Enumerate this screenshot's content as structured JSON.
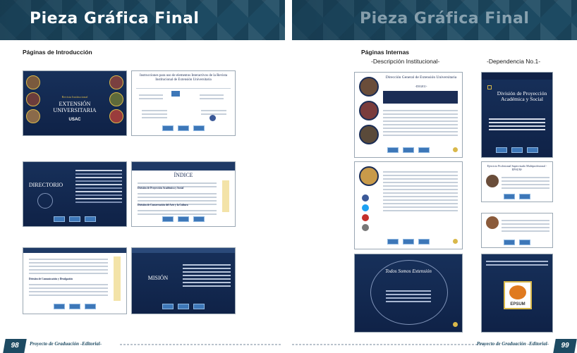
{
  "left_page": {
    "title": "Pieza Gráfica Final",
    "section": "Páginas de Introducción",
    "page_number": "98",
    "footer": "Proyecto de Graduación -Editorial-",
    "cover": {
      "line1": "Revista Institucional",
      "line2": "EXTENSIÓN",
      "line3": "UNIVERSITARIA",
      "logo": "USAC"
    },
    "instructions": {
      "title": "Instrucciones para uso de elementos Interactivos de la Revista Institucional de Extensión Universitaria"
    },
    "directorio": {
      "title": "DIRECTORIO"
    },
    "indice": {
      "title": "ÍNDICE",
      "heading1": "División de Proyección Académica y Social",
      "heading2": "División de Conservación del Arte y la Cultura"
    },
    "indice_cont": {
      "heading": "División de Comunicación y Divulgación"
    },
    "mision": {
      "title": "MISIÓN"
    }
  },
  "right_page": {
    "title": "Pieza Gráfica Final",
    "section": "Páginas Internas",
    "subsection_left": "-Descripción Institucional-",
    "subsection_right": "-Dependencia No.1-",
    "page_number": "99",
    "footer": "Proyecto de Graduación -Editorial-",
    "digeu": {
      "title": "Dirección General de Extensión Universitaria",
      "acronym": "-DIGEU-"
    },
    "division": {
      "title": "División de Proyección Académica y Social"
    },
    "epsum": {
      "title": "Ejercicio Profesional Supervisado Multiprofesional -EPSUM-",
      "logo": "EPSUM"
    },
    "todos_somos": {
      "text": "Todos Somos Extensión"
    }
  },
  "colors": {
    "band": "#1d4a62",
    "navy": "#17305a",
    "accent_gold": "#d9b84a",
    "button_blue": "#3d77b8"
  }
}
